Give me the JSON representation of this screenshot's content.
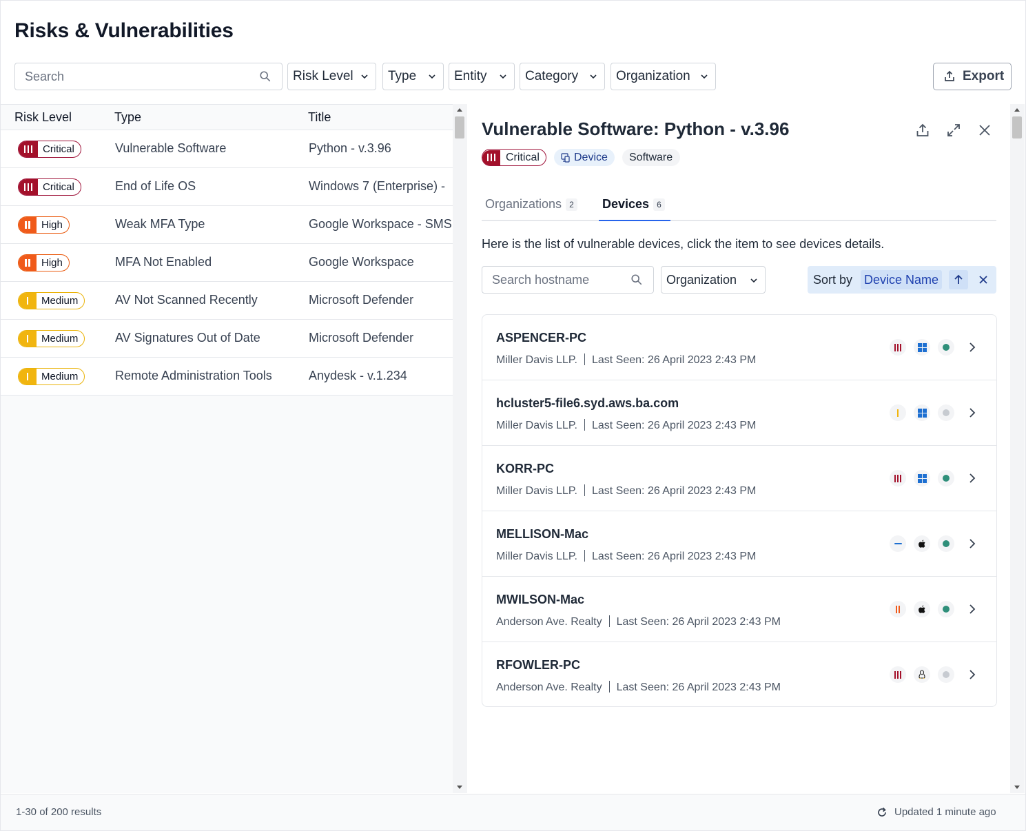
{
  "page": {
    "title": "Risks & Vulnerabilities"
  },
  "filters": {
    "search_placeholder": "Search",
    "risk_level": "Risk Level",
    "type": "Type",
    "entity": "Entity",
    "category": "Category",
    "organization": "Organization",
    "export_label": "Export"
  },
  "table": {
    "headers": {
      "risk_level": "Risk Level",
      "type": "Type",
      "title": "Title"
    },
    "rows": [
      {
        "risk": "Critical",
        "type": "Vulnerable Software",
        "title": "Python - v.3.96"
      },
      {
        "risk": "Critical",
        "type": "End of Life OS",
        "title": "Windows 7 (Enterprise) -"
      },
      {
        "risk": "High",
        "type": "Weak MFA Type",
        "title": "Google Workspace - SMS"
      },
      {
        "risk": "High",
        "type": "MFA Not Enabled",
        "title": "Google Workspace"
      },
      {
        "risk": "Medium",
        "type": "AV Not Scanned Recently",
        "title": "Microsoft Defender"
      },
      {
        "risk": "Medium",
        "type": "AV Signatures Out of Date",
        "title": "Microsoft Defender"
      },
      {
        "risk": "Medium",
        "type": "Remote Administration Tools",
        "title": "Anydesk - v.1.234"
      }
    ]
  },
  "detail": {
    "title": "Vulnerable Software: Python - v.3.96",
    "tags": {
      "risk": "Critical",
      "entity": "Device",
      "category": "Software"
    },
    "tabs": [
      {
        "label": "Organizations",
        "count": "2"
      },
      {
        "label": "Devices",
        "count": "6"
      }
    ],
    "hint": "Here is the list of vulnerable devices, click the item to see devices details.",
    "search_placeholder": "Search hostname",
    "org_filter": "Organization",
    "sort": {
      "prefix": "Sort by",
      "value": "Device Name"
    },
    "devices": [
      {
        "name": "ASPENCER-PC",
        "org": "Miller Davis LLP.",
        "last_seen": "Last Seen: 26 April 2023 2:43 PM",
        "risk_icon": "critical-bars-icon",
        "os_icon": "windows-icon",
        "status_icon": "status-online-dot"
      },
      {
        "name": "hcluster5-file6.syd.aws.ba.com",
        "org": "Miller Davis LLP.",
        "last_seen": "Last Seen: 26 April 2023 2:43 PM",
        "risk_icon": "medium-bar-icon",
        "os_icon": "windows-icon",
        "status_icon": "status-offline-dot"
      },
      {
        "name": "KORR-PC",
        "org": "Miller Davis LLP.",
        "last_seen": "Last Seen: 26 April 2023 2:43 PM",
        "risk_icon": "critical-bars-icon",
        "os_icon": "windows-icon",
        "status_icon": "status-online-dot"
      },
      {
        "name": "MELLISON-Mac",
        "org": "Miller Davis LLP.",
        "last_seen": "Last Seen: 26 April 2023 2:43 PM",
        "risk_icon": "none-dash-icon",
        "os_icon": "apple-icon",
        "status_icon": "status-online-dot"
      },
      {
        "name": "MWILSON-Mac",
        "org": "Anderson Ave. Realty",
        "last_seen": "Last Seen: 26 April 2023 2:43 PM",
        "risk_icon": "high-bars-icon",
        "os_icon": "apple-icon",
        "status_icon": "status-online-dot"
      },
      {
        "name": "RFOWLER-PC",
        "org": "Anderson Ave. Realty",
        "last_seen": "Last Seen: 26 April 2023 2:43 PM",
        "risk_icon": "critical-bars-icon",
        "os_icon": "linux-icon",
        "status_icon": "status-offline-dot"
      }
    ]
  },
  "footer": {
    "results": "1-30 of 200 results",
    "updated": "Updated 1 minute ago"
  },
  "colors": {
    "critical": "#a3102a",
    "high": "#f05a1a",
    "medium": "#f1b50f",
    "accent": "#2563eb",
    "online": "#2f8f7a",
    "offline": "#c7cbd1",
    "windows": "#1d6fd1"
  }
}
